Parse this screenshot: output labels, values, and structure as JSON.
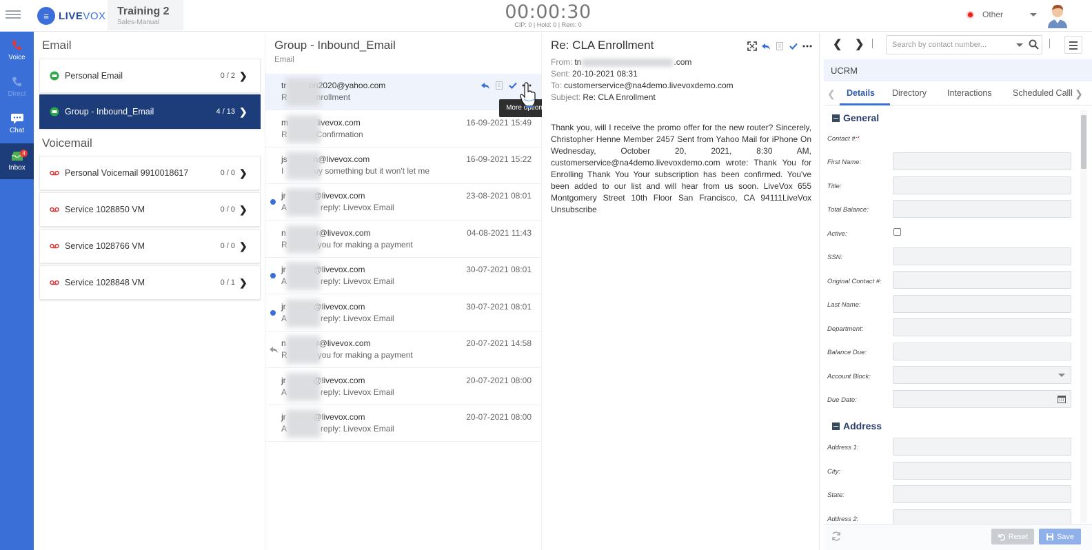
{
  "topbar": {
    "logo_text": "LIVE",
    "logo_text2": "VOX",
    "campaign_name": "Training 2",
    "campaign_mode": "Sales-Manual",
    "timer": "00:00:30",
    "timer_stats": "CIP: 0 | Hold: 0 | Rem: 0",
    "status_label": "Other",
    "status_color": "#e8211b"
  },
  "leftnav": {
    "items": [
      {
        "label": "Voice",
        "icon": "phone-icon"
      },
      {
        "label": "Direct",
        "icon": "direct-phone-icon"
      },
      {
        "label": "Chat",
        "icon": "chat-icon"
      },
      {
        "label": "Inbox",
        "icon": "inbox-icon",
        "badge": "4"
      }
    ]
  },
  "mailboxes": {
    "email_title": "Email",
    "voicemail_title": "Voicemail",
    "email_boxes": [
      {
        "label": "Personal Email",
        "count": "0 / 2"
      },
      {
        "label": "Group - Inbound_Email",
        "count": "4 / 13"
      }
    ],
    "voicemail_boxes": [
      {
        "label": "Personal Voicemail 9910018617",
        "count": "0 / 0"
      },
      {
        "label": "Service 1028850 VM",
        "count": "0 / 0"
      },
      {
        "label": "Service 1028766 VM",
        "count": "0 / 0"
      },
      {
        "label": "Service 1028848 VM",
        "count": "0 / 1"
      }
    ]
  },
  "emaillist": {
    "title": "Group - Inbound_Email",
    "subtitle": "Email",
    "tooltip": "More options",
    "rows": [
      {
        "from_a": "tr",
        "from_b": "on2020@yahoo.com",
        "subj_a": "R",
        "subj_b": "nrollment",
        "date": ""
      },
      {
        "from_a": "m",
        "from_b": "livevox.com",
        "subj_a": "R",
        "subj_b": "Confirmation",
        "date": "16-09-2021 15:49"
      },
      {
        "from_a": "js",
        "from_b": "n@livevox.com",
        "subj_a": "I",
        "subj_b": "uy something but it won't let me",
        "date": "16-09-2021 15:22"
      },
      {
        "from_a": "jr",
        "from_b": "@livevox.com",
        "subj_a": "A",
        "subj_b": "reply: Livevox Email",
        "date": "23-08-2021 08:01"
      },
      {
        "from_a": "n",
        "from_b": "r@livevox.com",
        "subj_a": "R",
        "subj_b": "you for making a payment",
        "date": "04-08-2021 11:43"
      },
      {
        "from_a": "jr",
        "from_b": "@livevox.com",
        "subj_a": "A",
        "subj_b": "reply: Livevox Email",
        "date": "30-07-2021 08:01"
      },
      {
        "from_a": "jr",
        "from_b": "@livevox.com",
        "subj_a": "A",
        "subj_b": "reply: Livevox Email",
        "date": "30-07-2021 08:01"
      },
      {
        "from_a": "n",
        "from_b": "r@livevox.com",
        "subj_a": "R",
        "subj_b": "you for making a payment",
        "date": "20-07-2021 14:58"
      },
      {
        "from_a": "jr",
        "from_b": "@livevox.com",
        "subj_a": "A",
        "subj_b": "reply: Livevox Email",
        "date": "20-07-2021 08:00"
      },
      {
        "from_a": "jr",
        "from_b": "@livevox.com",
        "subj_a": "A",
        "subj_b": "reply: Livevox Email",
        "date": "20-07-2021 08:00"
      }
    ]
  },
  "reader": {
    "title": "Re: CLA Enrollment",
    "from_label": "From:",
    "from_a": "tn",
    "from_b": ".com",
    "sent_label": "Sent:",
    "sent_value": "20-10-2021 08:31",
    "to_label": "To:",
    "to_value": "customerservice@na4demo.livevoxdemo.com",
    "subject_label": "Subject:",
    "subject_value": "Re: CLA Enrollment",
    "body": "Thank you, will I receive the promo offer for the new router? Sincerely, Christopher Henne Member 2457 Sent from Yahoo Mail for iPhone On Wednesday, October 20, 2021, 8:30 AM, customerservice@na4demo.livevoxdemo.com wrote: Thank You for Enrolling Thank You Your subscription has been confirmed. You've been added to our list and will hear from us soon. LiveVox 655 Montgomery Street 10th Floor San Francisco, CA 94111LiveVox Unsubscribe"
  },
  "crm": {
    "search_placeholder": "Search by contact number...",
    "header": "UCRM",
    "tabs": [
      "Details",
      "Directory",
      "Interactions",
      "Scheduled Calll"
    ],
    "general_title": "General",
    "address_title": "Address",
    "contact_label": "Contact #:",
    "required_mark": "*",
    "fields": {
      "first_name": "First Name:",
      "title": "Title:",
      "total_balance": "Total Balance:",
      "active": "Active:",
      "ssn": "SSN:",
      "original_contact": "Original Contact #:",
      "last_name": "Last Name:",
      "department": "Department:",
      "balance_due": "Balance Due:",
      "account_block": "Account Block:",
      "due_date": "Due Date:",
      "address1": "Address 1:",
      "city": "City:",
      "state": "State:",
      "address2": "Address 2:"
    },
    "reset_label": "Reset",
    "save_label": "Save"
  }
}
